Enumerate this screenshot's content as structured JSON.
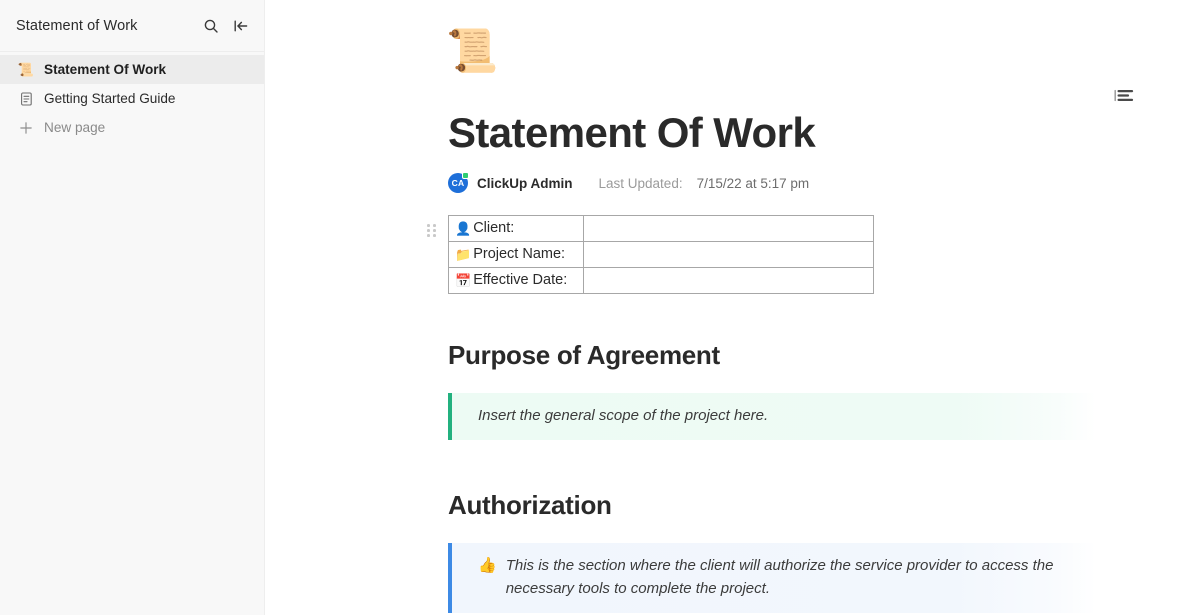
{
  "sidebar": {
    "title": "Statement of Work",
    "search_icon": "search-icon",
    "collapse_icon": "collapse-sidebar-icon",
    "items": [
      {
        "label": "Statement Of Work",
        "icon": "scroll-emoji",
        "glyph": "📜",
        "active": true
      },
      {
        "label": "Getting Started Guide",
        "icon": "document-icon",
        "glyph": "",
        "active": false
      },
      {
        "label": "New page",
        "icon": "plus-icon",
        "glyph": "",
        "active": false
      }
    ]
  },
  "document": {
    "cover_emoji": "📜",
    "title": "Statement Of Work",
    "author": "ClickUp Admin",
    "author_initials": "CA",
    "updated_label": "Last Updated:",
    "updated_value": "7/15/22 at 5:17 pm",
    "toc_icon": "table-of-contents-icon",
    "table": {
      "rows": [
        {
          "emoji": "👤",
          "label": "Client:",
          "value": ""
        },
        {
          "emoji": "📁",
          "label": "Project Name:",
          "value": ""
        },
        {
          "emoji": "📅",
          "label": "Effective Date:",
          "value": ""
        }
      ]
    },
    "sections": [
      {
        "heading": "Purpose of Agreement",
        "callout": {
          "emoji": "",
          "text": "Insert the general scope of the project here.",
          "color": "#23b17f"
        }
      },
      {
        "heading": "Authorization",
        "callout": {
          "emoji": "👍",
          "text": "This is the section where the client will authorize the service provider to access the necessary tools to complete the project.",
          "color": "#3d8ae5"
        }
      }
    ]
  }
}
